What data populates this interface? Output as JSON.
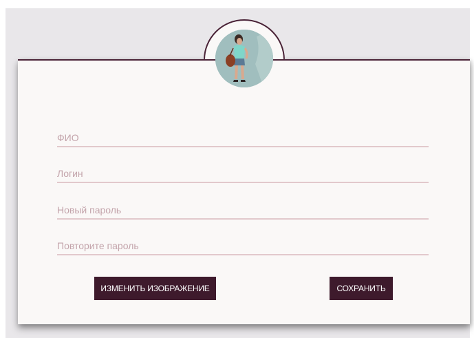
{
  "profile": {
    "avatar_icon": "user-photo"
  },
  "form": {
    "fields": [
      {
        "name": "fio",
        "placeholder": "ФИО",
        "value": ""
      },
      {
        "name": "login",
        "placeholder": "Логин",
        "value": ""
      },
      {
        "name": "new_password",
        "placeholder": "Новый пароль",
        "value": ""
      },
      {
        "name": "repeat_password",
        "placeholder": "Повторите пароль",
        "value": ""
      }
    ]
  },
  "actions": {
    "change_image_label": "ИЗМЕНИТЬ ИЗОБРАЖЕНИЕ",
    "save_label": "СОХРАНИТЬ"
  },
  "colors": {
    "accent": "#3e1a2c",
    "card_background": "#faf8f7",
    "page_background": "#e9e7ea",
    "underline": "#e2c9cc",
    "placeholder": "#c3a4ab"
  }
}
